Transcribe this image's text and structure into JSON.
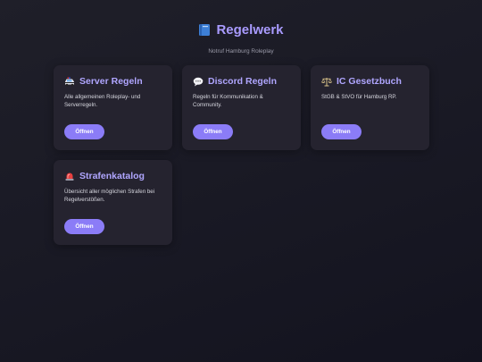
{
  "header": {
    "title": "Regelwerk",
    "subtitle": "Notruf Hamburg Roleplay",
    "icon": "book-icon"
  },
  "cards": [
    {
      "icon": "police-car-icon",
      "title": "Server Regeln",
      "description": "Alle allgemeinen Roleplay- und Serverregeln.",
      "button": "Öffnen"
    },
    {
      "icon": "speech-bubble-icon",
      "title": "Discord Regeln",
      "description": "Regeln für Kommunikation & Community.",
      "button": "Öffnen"
    },
    {
      "icon": "scales-icon",
      "title": "IC Gesetzbuch",
      "description": "StGB & StVO für Hamburg RP.",
      "button": "Öffnen"
    },
    {
      "icon": "siren-icon",
      "title": "Strafenkatalog",
      "description": "Übersicht aller möglichen Strafen bei Regelverstößen.",
      "button": "Öffnen"
    }
  ],
  "colors": {
    "accent": "#8b7cf7",
    "title": "#a99bff",
    "card_bg": "#25232f",
    "page_bg": "#1a1a25"
  }
}
